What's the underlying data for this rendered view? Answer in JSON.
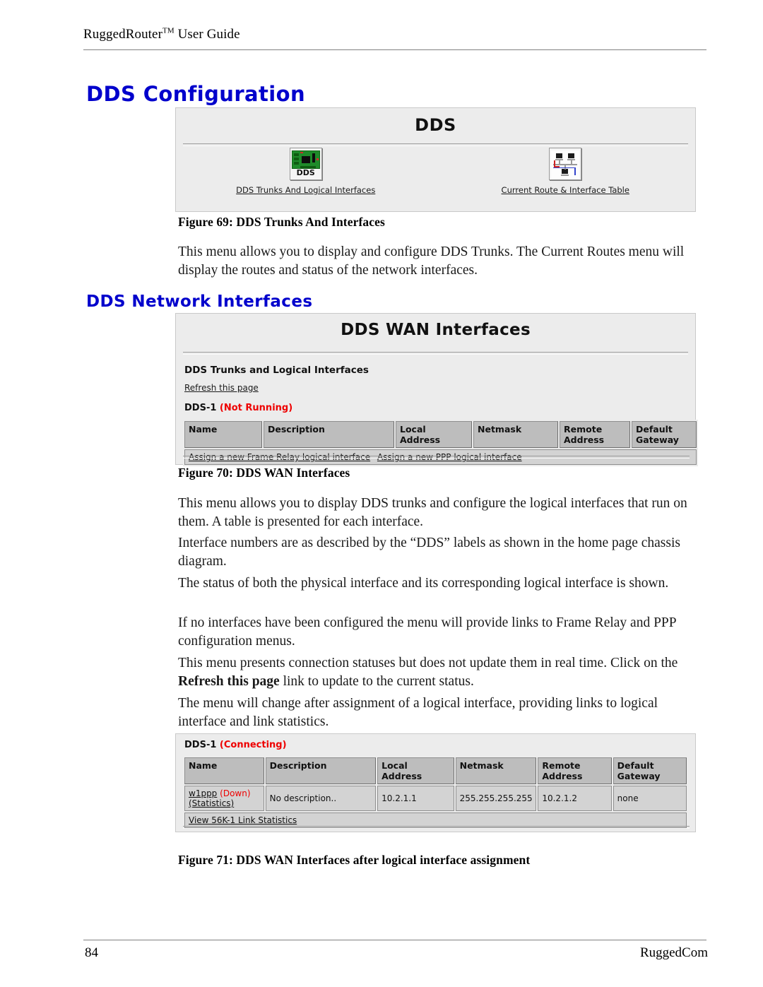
{
  "document": {
    "running_header": "RuggedRouter",
    "running_header_tm": "TM",
    "running_header_tail": " User Guide",
    "page_number": "84",
    "company": "RuggedCom"
  },
  "headings": {
    "main": "DDS Configuration",
    "sub": "DDS Network Interfaces"
  },
  "figure69": {
    "panel_title": "DDS",
    "icons": [
      {
        "icon_name": "dds-card-icon",
        "badge": "DDS",
        "label": "DDS Trunks And Logical Interfaces"
      },
      {
        "icon_name": "route-table-icon",
        "badge": "",
        "label": "Current Route & Interface Table"
      }
    ],
    "caption": "Figure 69: DDS Trunks And Interfaces"
  },
  "paragraphs": {
    "p1": "This menu allows you to display and configure DDS Trunks.  The Current Routes menu will display the routes and status of the network interfaces.",
    "p2": "This menu allows you to display DDS trunks and configure the logical interfaces that run on them.  A table is presented for each interface.",
    "p3": "Interface numbers are as described by the “DDS” labels as shown in the home page chassis diagram.",
    "p4": "The status of both the physical interface and its corresponding logical interface is shown.",
    "p5": "If no interfaces have been configured the menu will provide links to Frame Relay and PPP configuration menus.",
    "p6_a": "This menu presents connection statuses but does not update them in real time.  Click on the ",
    "p6_bold": "Refresh this page",
    "p6_b": " link to update to the current status.",
    "p7": "The menu will change after assignment of a logical interface, providing links to logical interface and link statistics."
  },
  "figure70": {
    "panel_title": "DDS WAN Interfaces",
    "section_title": "DDS Trunks and Logical Interfaces",
    "refresh_link": "Refresh this page",
    "trunk_name": "DDS-1",
    "trunk_state": "(Not Running)",
    "columns": [
      "Name",
      "Description",
      "Local Address",
      "Netmask",
      "Remote Address",
      "Default Gateway"
    ],
    "action_links": [
      "Assign a new Frame Relay logical interface",
      "Assign a new PPP logical interface"
    ],
    "caption": "Figure 70: DDS WAN Interfaces"
  },
  "figure71": {
    "trunk_name": "DDS-1",
    "trunk_state": "(Connecting)",
    "columns": [
      "Name",
      "Description",
      "Local Address",
      "Netmask",
      "Remote",
      "Default"
    ],
    "columns_line2": [
      "",
      "",
      "",
      "",
      "Address",
      "Gateway"
    ],
    "row": {
      "name": "w1ppp",
      "name_state": "(Down)",
      "name_stats": "(Statistics)",
      "description": "No description..",
      "local_address": "10.2.1.1",
      "netmask": "255.255.255.255",
      "remote_address": "10.2.1.2",
      "default_gateway": "none"
    },
    "footer_link": "View 56K-1 Link Statistics",
    "caption": "Figure 71: DDS WAN Interfaces after logical interface assignment"
  },
  "colors": {
    "heading_blue": "#0000cc",
    "status_red": "#ee0000",
    "panel_bg": "#ececec",
    "table_header_bg": "#bdbdbd",
    "table_cell_bg": "#d3d3d3"
  }
}
